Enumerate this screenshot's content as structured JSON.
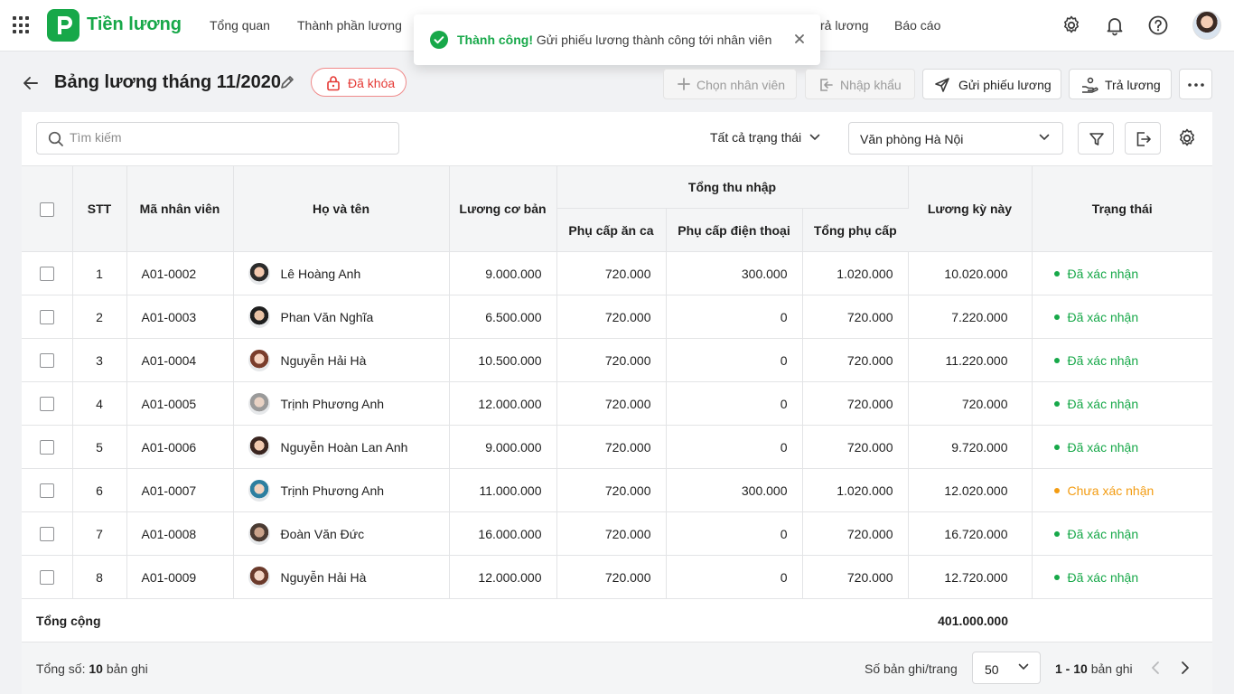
{
  "nav": {
    "app_name": "Tiền lương",
    "items": [
      {
        "label": "Tổng quan"
      },
      {
        "label": "Thành phần lương"
      },
      {
        "label": "rả lương"
      },
      {
        "label": "Báo cáo"
      }
    ]
  },
  "toast": {
    "title": "Thành công!",
    "message": "Gửi phiếu lương thành công tới nhân viên"
  },
  "header": {
    "title": "Bảng lương tháng 11/2020",
    "locked_label": "Đã khóa",
    "buttons": {
      "choose_employee": "Chọn nhân viên",
      "import": "Nhập khẩu",
      "send_payslip": "Gửi phiếu lương",
      "pay": "Trả lương"
    }
  },
  "toolbar": {
    "search_placeholder": "Tìm kiếm",
    "status_filter": "Tất cả trạng thái",
    "office": "Văn phòng Hà Nội"
  },
  "table": {
    "headers": {
      "stt": "STT",
      "code": "Mã nhân viên",
      "name": "Họ và tên",
      "base_salary": "Lương cơ bản",
      "total_income": "Tổng thu nhập",
      "meal_allowance": "Phụ cấp ăn ca",
      "phone_allowance": "Phụ cấp điện thoại",
      "total_allowance": "Tổng phụ cấp",
      "period_salary": "Lương kỳ này",
      "status": "Trạng thái"
    },
    "rows": [
      {
        "stt": "1",
        "code": "A01-0002",
        "name": "Lê Hoàng Anh",
        "base": "9.000.000",
        "meal": "720.000",
        "phone": "300.000",
        "allow": "1.020.000",
        "salary": "10.020.000",
        "status": "Đã xác nhận",
        "status_type": "confirmed"
      },
      {
        "stt": "2",
        "code": "A01-0003",
        "name": "Phan Văn Nghĩa",
        "base": "6.500.000",
        "meal": "720.000",
        "phone": "0",
        "allow": "720.000",
        "salary": "7.220.000",
        "status": "Đã xác nhận",
        "status_type": "confirmed"
      },
      {
        "stt": "3",
        "code": "A01-0004",
        "name": "Nguyễn Hải Hà",
        "base": "10.500.000",
        "meal": "720.000",
        "phone": "0",
        "allow": "720.000",
        "salary": "11.220.000",
        "status": "Đã xác nhận",
        "status_type": "confirmed"
      },
      {
        "stt": "4",
        "code": "A01-0005",
        "name": "Trịnh Phương Anh",
        "base": "12.000.000",
        "meal": "720.000",
        "phone": "0",
        "allow": "720.000",
        "salary": "720.000",
        "status": "Đã xác nhận",
        "status_type": "confirmed"
      },
      {
        "stt": "5",
        "code": "A01-0006",
        "name": "Nguyễn Hoàn Lan Anh",
        "base": "9.000.000",
        "meal": "720.000",
        "phone": "0",
        "allow": "720.000",
        "salary": "9.720.000",
        "status": "Đã xác nhận",
        "status_type": "confirmed"
      },
      {
        "stt": "6",
        "code": "A01-0007",
        "name": "Trịnh Phương Anh",
        "base": "11.000.000",
        "meal": "720.000",
        "phone": "300.000",
        "allow": "1.020.000",
        "salary": "12.020.000",
        "status": "Chưa xác nhận",
        "status_type": "pending"
      },
      {
        "stt": "7",
        "code": "A01-0008",
        "name": "Đoàn Văn Đức",
        "base": "16.000.000",
        "meal": "720.000",
        "phone": "0",
        "allow": "720.000",
        "salary": "16.720.000",
        "status": "Đã xác nhận",
        "status_type": "confirmed"
      },
      {
        "stt": "8",
        "code": "A01-0009",
        "name": "Nguyễn Hải Hà",
        "base": "12.000.000",
        "meal": "720.000",
        "phone": "0",
        "allow": "720.000",
        "salary": "12.720.000",
        "status": "Đã xác nhận",
        "status_type": "confirmed"
      }
    ],
    "total_label": "Tổng cộng",
    "total_value": "401.000.000"
  },
  "footer": {
    "total_prefix": "Tổng số:",
    "total_count": "10",
    "total_suffix": "bản ghi",
    "per_page_label": "Số bản ghi/trang",
    "per_page": "50",
    "range": "1 - 10",
    "range_suffix": "bản ghi"
  },
  "colors": {
    "brand": "#17a849",
    "confirmed": "#17a849",
    "pending": "#f39c12",
    "locked": "#e53935"
  }
}
